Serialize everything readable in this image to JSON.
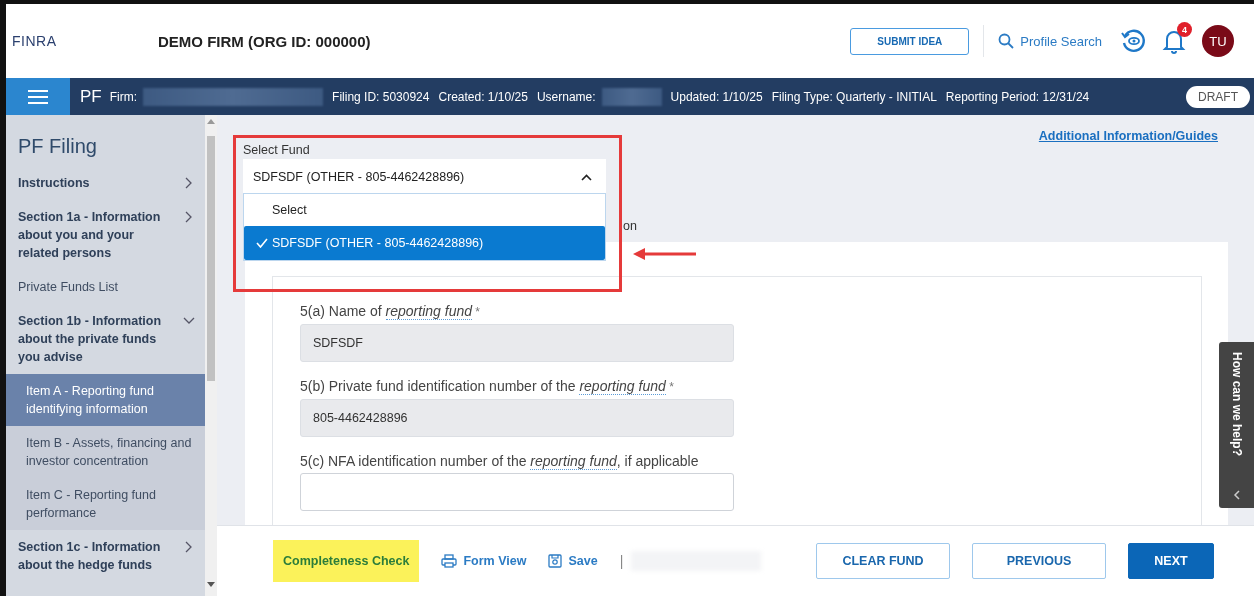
{
  "header": {
    "logo": "FINRA",
    "firm_title": "DEMO FIRM (ORG ID: 000000)",
    "submit_idea": "SUBMIT IDEA",
    "profile_search": "Profile Search",
    "notification_count": "4",
    "avatar_initials": "TU"
  },
  "filing_bar": {
    "app": "PF",
    "items": [
      {
        "label": "Firm:",
        "blurred": true
      },
      {
        "label": "Filing ID: 5030924",
        "blurred": false
      },
      {
        "label": "Created: 1/10/25",
        "blurred": false
      },
      {
        "label": "Username:",
        "blurred": true
      },
      {
        "label": "Updated: 1/10/25",
        "blurred": false
      },
      {
        "label": "Filing Type: Quarterly - INITIAL",
        "blurred": false
      },
      {
        "label": "Reporting Period: 12/31/24",
        "blurred": false
      }
    ],
    "status": "DRAFT"
  },
  "sidebar": {
    "title": "PF Filing",
    "items": [
      {
        "kind": "section",
        "label": "Instructions",
        "expanded": false,
        "selected": false
      },
      {
        "kind": "section",
        "label": "Section 1a - Information about you and your related persons",
        "expanded": false,
        "selected": false
      },
      {
        "kind": "link",
        "label": "Private Funds List",
        "selected": false
      },
      {
        "kind": "section",
        "label": "Section 1b - Information about the private funds you advise",
        "expanded": true,
        "selected": false
      },
      {
        "kind": "sub",
        "label": "Item A - Reporting fund identifying information",
        "selected": true
      },
      {
        "kind": "sub",
        "label": "Item B - Assets, financing and investor concentration",
        "selected": false
      },
      {
        "kind": "sub",
        "label": "Item C - Reporting fund performance",
        "selected": false
      },
      {
        "kind": "section",
        "label": "Section 1c - Information about the hedge funds",
        "expanded": false,
        "selected": false
      }
    ]
  },
  "main": {
    "guides_link": "Additional Information/Guides",
    "select_fund": {
      "label": "Select Fund",
      "value": "SDFSDF (OTHER - 805-4462428896)",
      "expanded": true,
      "options": [
        {
          "label": "Select",
          "selected": false
        },
        {
          "label": "SDFSDF (OTHER - 805-4462428896)",
          "selected": true
        }
      ]
    },
    "hidden_heading_tail": "on",
    "fields": [
      {
        "prefix": "5(a) Name of",
        "term": "reporting fund",
        "required_mark": "*",
        "value": "SDFSDF",
        "readonly": true
      },
      {
        "prefix": "5(b) Private fund identification number of the",
        "term": "reporting fund",
        "required_mark": "*",
        "value": "805-4462428896",
        "readonly": true
      },
      {
        "prefix": "5(c) NFA identification number of the",
        "term": "reporting fund",
        "suffix": ", if applicable",
        "readonly": false
      }
    ]
  },
  "help_tab": "How can we help?",
  "footer": {
    "actions": [
      {
        "kind": "check",
        "label": "Completeness Check",
        "highlighted": true
      },
      {
        "kind": "print",
        "label": "Form View",
        "highlighted": false
      },
      {
        "kind": "save",
        "label": "Save",
        "highlighted": false
      }
    ],
    "separator": "|",
    "buttons": [
      {
        "label": "CLEAR FUND",
        "primary": false
      },
      {
        "label": "PREVIOUS",
        "primary": false
      },
      {
        "label": "NEXT",
        "primary": true
      }
    ]
  }
}
